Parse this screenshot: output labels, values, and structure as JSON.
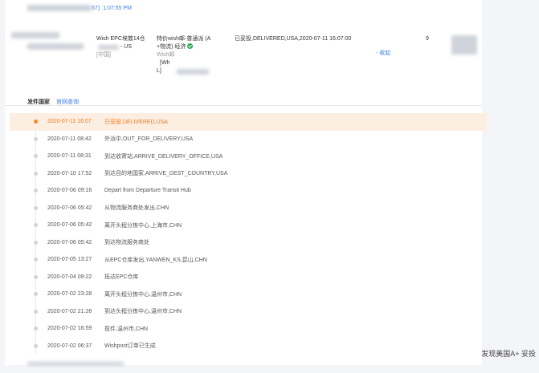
{
  "header": {
    "link_suffix": "67)",
    "time": "1:07:55 PM"
  },
  "order": {
    "product_line1": "Wish EPC埃敦14仓",
    "product_line2": "- US",
    "product_line3": "[中国]",
    "service_line1": "特价wish邮-普通派 (A",
    "service_line2": "+物流) 经济",
    "service_line3": "Wish邮",
    "service_line4": "[Wh",
    "service_line5": "L]",
    "status": "已妥投,DELIVERED,USA,2020-07-11 16:07:00",
    "action": "- 收起",
    "count": "9"
  },
  "tracking": {
    "label": "发件国家",
    "query_link": "官网查询",
    "events": [
      {
        "date": "2020-07-11 16:07",
        "desc": "已妥投,DELIVERED,USA",
        "current": true
      },
      {
        "date": "2020-07-11 08:42",
        "desc": "外派中,OUT_FOR_DELIVERY,USA"
      },
      {
        "date": "2020-07-11 08:31",
        "desc": "到达收寄站,ARRIVE_DELIVERY_OFFICE,USA"
      },
      {
        "date": "2020-07-10 17:52",
        "desc": "到达目的地国家,ARRIVE_DEST_COUNTRY,USA"
      },
      {
        "date": "2020-07-06 09:16",
        "desc": "Depart from Departure Transit Hub"
      },
      {
        "date": "2020-07-06 05:42",
        "desc": "从物流服务商处发出,CHN"
      },
      {
        "date": "2020-07-06 05:42",
        "desc": "离开头程分拣中心,上海市,CHN"
      },
      {
        "date": "2020-07-06 05:42",
        "desc": "到达物流服务商处"
      },
      {
        "date": "2020-07-05 13:27",
        "desc": "从EPC仓库发出,YANWEN_KS,昆山,CHN"
      },
      {
        "date": "2020-07-04 09:22",
        "desc": "抵达EPC仓库"
      },
      {
        "date": "2020-07-02 23:28",
        "desc": "离开头程分拣中心,温州市,CHN"
      },
      {
        "date": "2020-07-02 21:26",
        "desc": "到达头程分拣中心,温州市,CHN"
      },
      {
        "date": "2020-07-02 16:59",
        "desc": "揽件,温州市,CHN"
      },
      {
        "date": "2020-07-02 06:37",
        "desc": "Wishpost订单已生成"
      }
    ]
  },
  "watermark": "发现美国A+ 妥投",
  "colors": {
    "accent_blue": "#3a7be0",
    "current_orange": "#ef7a18",
    "current_bg": "#fdeee2",
    "check_green": "#2aa84a"
  }
}
